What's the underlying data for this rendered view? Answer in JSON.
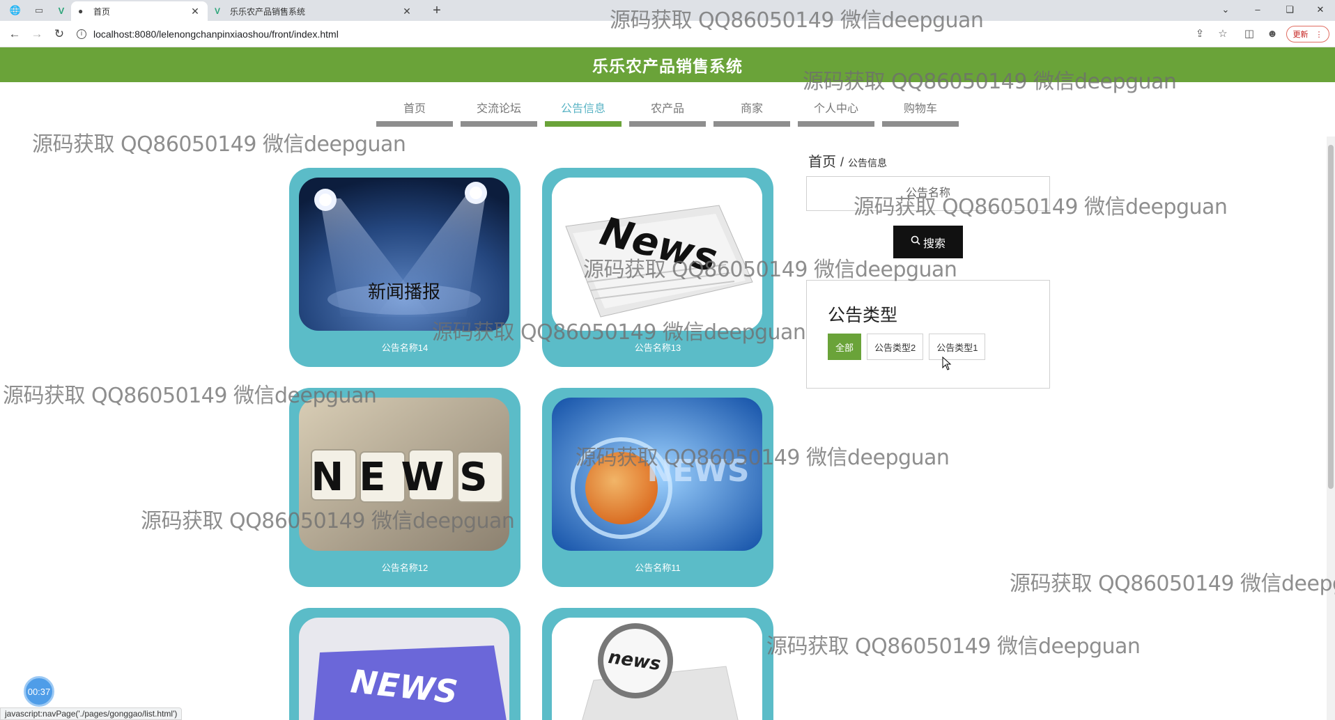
{
  "browser": {
    "tabs": [
      {
        "title": "首页",
        "active": true
      },
      {
        "title": "乐乐农产品销售系统",
        "active": false
      }
    ],
    "url": "localhost:8080/lelenongchanpinxiaoshou/front/index.html",
    "update_label": "更新"
  },
  "site": {
    "title": "乐乐农产品销售系统",
    "nav": [
      {
        "label": "首页",
        "active": false
      },
      {
        "label": "交流论坛",
        "active": false
      },
      {
        "label": "公告信息",
        "active": true
      },
      {
        "label": "农产品",
        "active": false
      },
      {
        "label": "商家",
        "active": false
      },
      {
        "label": "个人中心",
        "active": false
      },
      {
        "label": "购物车",
        "active": false
      }
    ]
  },
  "breadcrumb": {
    "home": "首页",
    "separator": "/",
    "current": "公告信息"
  },
  "search": {
    "placeholder": "公告名称",
    "button_label": "搜索"
  },
  "types": {
    "title": "公告类型",
    "items": [
      {
        "label": "全部",
        "active": true
      },
      {
        "label": "公告类型2",
        "active": false
      },
      {
        "label": "公告类型1",
        "active": false
      }
    ]
  },
  "cards": [
    {
      "name": "公告名称14",
      "image_text": "新闻播报"
    },
    {
      "name": "公告名称13",
      "image_text": "News"
    },
    {
      "name": "公告名称12",
      "image_text": "NEWS"
    },
    {
      "name": "公告名称11",
      "image_text": "NEWS"
    },
    {
      "name": "",
      "image_text": "NEWS"
    },
    {
      "name": "",
      "image_text": "news"
    }
  ],
  "status_url": "javascript:navPage('./pages/gonggao/list.html')",
  "timer": "00:37",
  "watermark": "源码获取 QQ86050149 微信deepguan",
  "colors": {
    "header_green": "#6aa339",
    "card_teal": "#5bbcc8",
    "nav_active_text": "#5bb4c5",
    "search_button": "#111111"
  }
}
